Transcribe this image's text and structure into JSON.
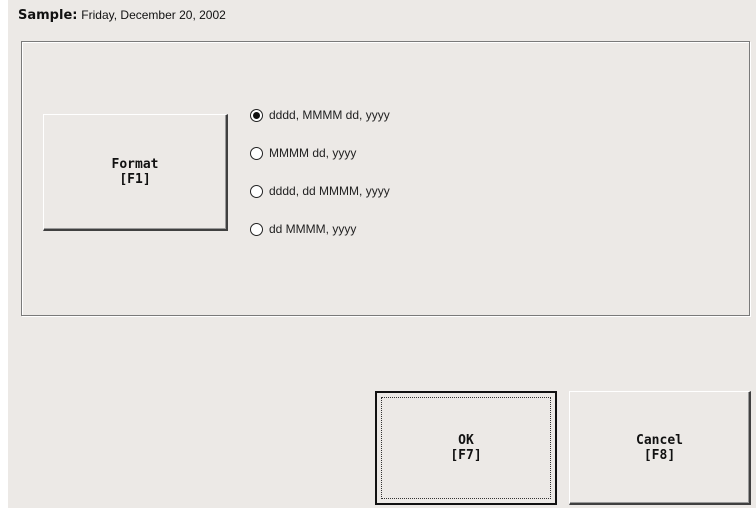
{
  "sample": {
    "label": "Sample:",
    "value": "Friday, December 20, 2002"
  },
  "format_button": {
    "line1": "Format",
    "line2": "[F1]"
  },
  "format_options": [
    {
      "label": "dddd, MMMM dd, yyyy",
      "selected": true
    },
    {
      "label": "MMMM dd, yyyy",
      "selected": false
    },
    {
      "label": "dddd, dd MMMM, yyyy",
      "selected": false
    },
    {
      "label": "dd MMMM, yyyy",
      "selected": false
    }
  ],
  "ok_button": {
    "line1": "OK",
    "line2": "[F7]"
  },
  "cancel_button": {
    "line1": "Cancel",
    "line2": "[F8]"
  }
}
